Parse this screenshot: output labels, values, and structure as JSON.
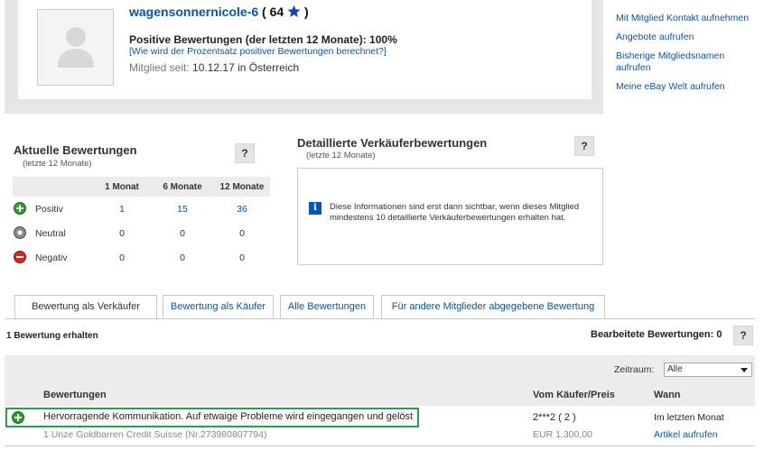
{
  "profile": {
    "username": "wagensonnernicole-6",
    "score_prefix": "(",
    "score": "64",
    "score_suffix": ")",
    "positive_pct": "Positive Bewertungen (der letzten 12 Monate): 100%",
    "calc_link": "[Wie wird der Prozentsatz positiver Bewertungen berechnet?]",
    "member_since_label": "Mitglied seit:",
    "member_since_value": "10.12.17 in Österreich",
    "star_color": "#1c3fb8"
  },
  "right_links": [
    "Mit Mitglied Kontakt aufnehmen",
    "Angebote aufrufen",
    "Bisherige Mitgliedsnamen aufrufen",
    "Meine eBay Welt aufrufen"
  ],
  "current": {
    "title": "Aktuelle Bewertungen",
    "subtitle": "(letzte 12 Monate)",
    "help": "?",
    "columns": [
      "1 Monat",
      "6 Monate",
      "12 Monate"
    ],
    "rows": [
      {
        "label": "Positiv",
        "values": [
          "1",
          "15",
          "36"
        ],
        "color": "#2a9d2a"
      },
      {
        "label": "Neutral",
        "values": [
          "0",
          "0",
          "0"
        ],
        "color": "#8a8a8a"
      },
      {
        "label": "Negativ",
        "values": [
          "0",
          "0",
          "0"
        ],
        "color": "#d9261c"
      }
    ]
  },
  "detailed": {
    "title": "Detaillierte Verkäuferbewertungen",
    "subtitle": "(letzte 12 Monate)",
    "help": "?",
    "info_text": "Diese Informationen sind erst dann sichtbar, wenn dieses Mitglied mindestens 10 detaillierte Verkäuferbewertungen erhalten hat."
  },
  "tabs": [
    "Bewertung als Verkäufer",
    "Bewertung als Käufer",
    "Alle Bewertungen",
    "Für andere Mitglieder abgegebene Bewertung"
  ],
  "results": {
    "count": "1 Bewertung erhalten",
    "edited": "Bearbeitete Bewertungen: 0",
    "help": "?",
    "period_label": "Zeitraum:",
    "period_value": "Alle",
    "headers": {
      "feedback": "Bewertungen",
      "buyer": "Vom Käufer/Preis",
      "when": "Wann"
    },
    "row": {
      "comment": "Hervorragende Kommunikation. Auf etwaige Probleme wird eingegangen und gelöst",
      "buyer": "2***2 ( 2 )",
      "when": "Im letzten Monat",
      "item": "1 Unze Goldbarren Credit Suisse (Nr.273980807794)",
      "price": "EUR 1.300,00",
      "item_link": "Artikel aufrufen",
      "highlight_color": "#1ea64a"
    }
  }
}
